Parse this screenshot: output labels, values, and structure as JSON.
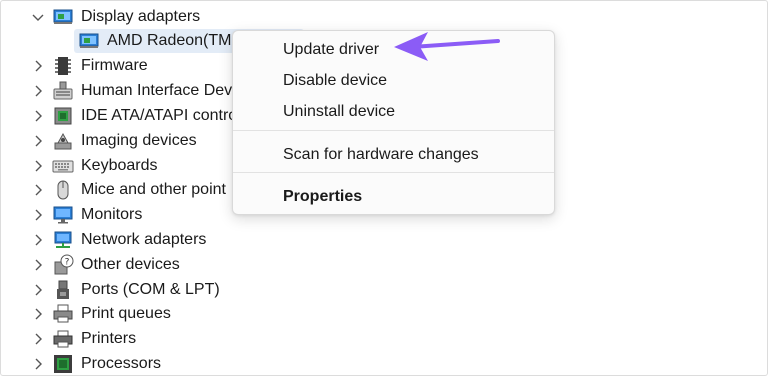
{
  "device_tree": {
    "categories": [
      {
        "label": "Display adapters",
        "icon": "display-adapter-icon",
        "expanded": true
      },
      {
        "label": "Firmware",
        "icon": "firmware-icon"
      },
      {
        "label": "Human Interface Dev",
        "icon": "hid-icon"
      },
      {
        "label": "IDE ATA/ATAPI control",
        "icon": "ide-controller-icon"
      },
      {
        "label": "Imaging devices",
        "icon": "camera-icon"
      },
      {
        "label": "Keyboards",
        "icon": "keyboard-icon"
      },
      {
        "label": "Mice and other point",
        "icon": "mouse-icon"
      },
      {
        "label": "Monitors",
        "icon": "monitor-icon"
      },
      {
        "label": "Network adapters",
        "icon": "network-adapter-icon"
      },
      {
        "label": "Other devices",
        "icon": "unknown-device-icon"
      },
      {
        "label": "Ports (COM & LPT)",
        "icon": "port-icon"
      },
      {
        "label": "Print queues",
        "icon": "print-queue-icon"
      },
      {
        "label": "Printers",
        "icon": "printer-icon"
      },
      {
        "label": "Processors",
        "icon": "processor-icon"
      }
    ],
    "selected_child": {
      "label": "AMD Radeon(TM",
      "icon": "display-adapter-icon"
    }
  },
  "context_menu": {
    "items": [
      {
        "label": "Update driver"
      },
      {
        "label": "Disable device"
      },
      {
        "label": "Uninstall device"
      },
      {
        "label": "Scan for hardware changes"
      },
      {
        "label": "Properties",
        "bold": true
      }
    ]
  },
  "annotation": {
    "arrow_color": "#8b5cf6"
  },
  "colors": {
    "selection": "#e3ecf7",
    "icon_blue": "#2b7fd6",
    "icon_green": "#2ea043"
  }
}
